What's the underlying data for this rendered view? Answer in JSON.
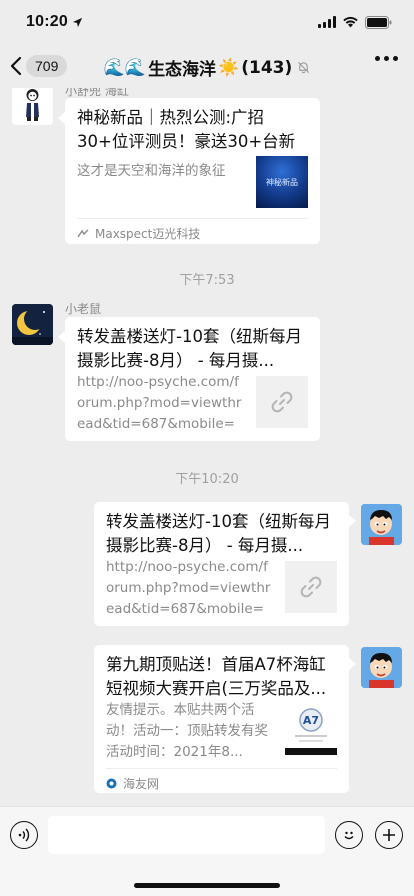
{
  "status": {
    "time": "10:20"
  },
  "nav": {
    "back_count": "709",
    "title_prefix": "🌊🌊",
    "title_text": "生态海洋",
    "title_emoji": "☀️",
    "member_count": "(143)"
  },
  "messages": [
    {
      "sender": "小舒兜 海缸",
      "title": "神秘新品｜热烈公测:广招30+位评测员！豪送30+台新品...",
      "desc": "这才是天空和海洋的象征",
      "thumb_text": "神秘新品",
      "source": "Maxspect迈光科技"
    },
    {
      "time_sep": "下午7:53"
    },
    {
      "sender": "小老鼠",
      "title": "转发盖楼送灯-10套（纽斯每月摄影比赛-8月） - 每月摄...",
      "desc": "http://noo-psyche.com/forum.php?mod=viewthread&tid=687&mobile=2"
    },
    {
      "time_sep": "下午10:20"
    },
    {
      "title": "转发盖楼送灯-10套（纽斯每月摄影比赛-8月） - 每月摄...",
      "desc": "http://noo-psyche.com/forum.php?mod=viewthread&tid=687&mobile=2"
    },
    {
      "title": "第九期顶贴送！首届A7杯海缸短视频大赛开启(三万奖品及...",
      "desc": "友情提示。本贴共两个活动！活动一：顶贴转发有奖活动时间：2021年8...",
      "source": "海友网"
    }
  ],
  "colors": {
    "background": "#ededed",
    "card": "#ffffff",
    "muted": "#8a8a8a"
  }
}
